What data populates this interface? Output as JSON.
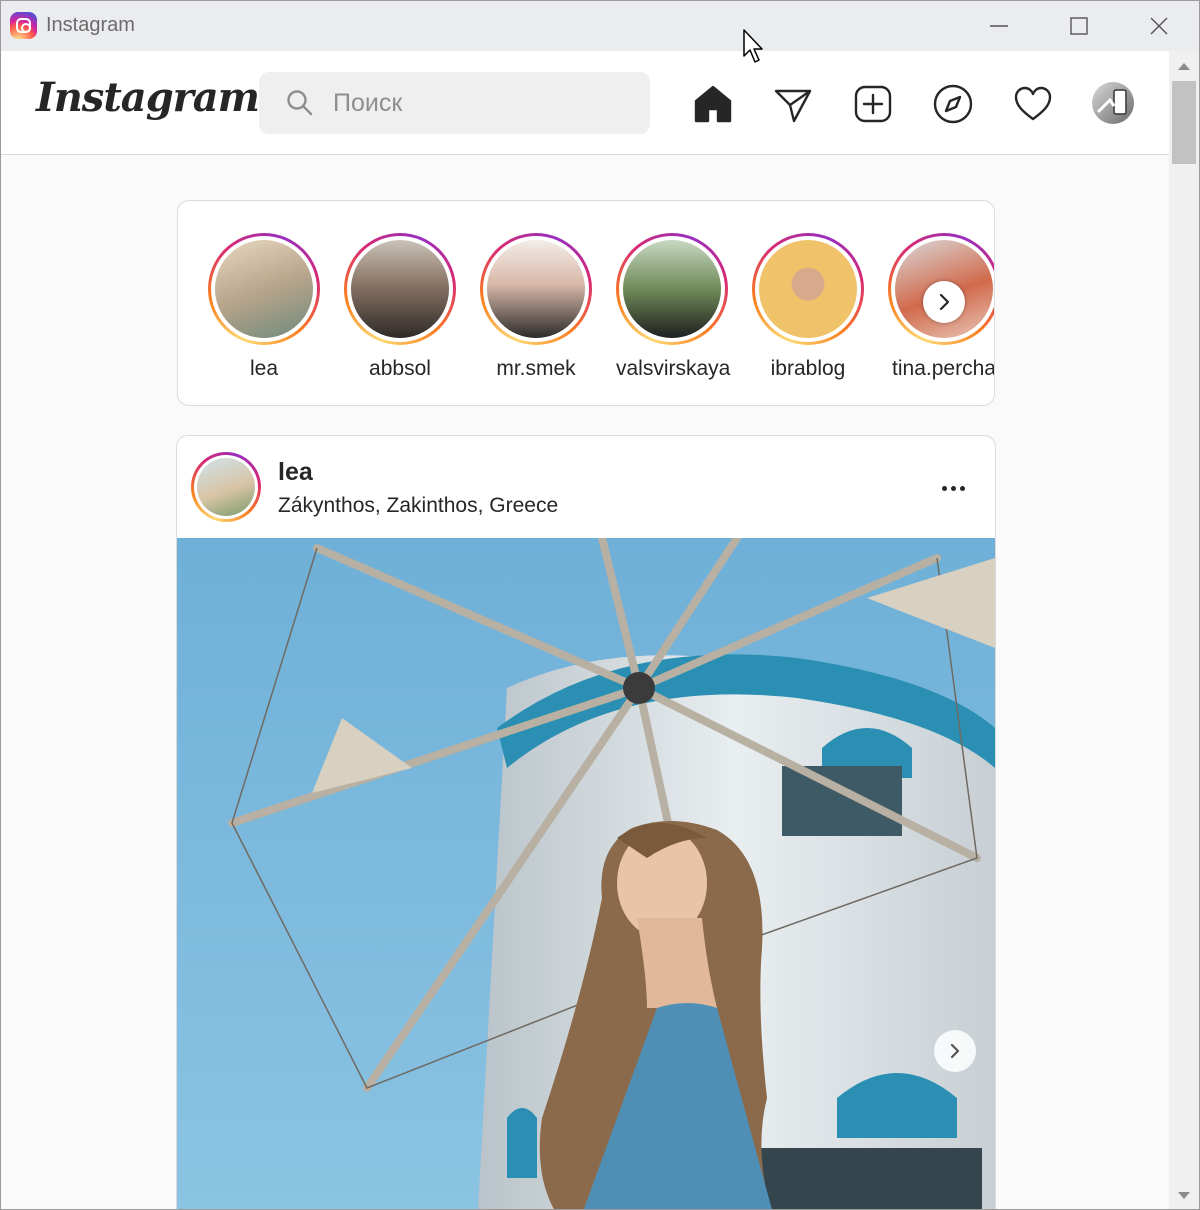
{
  "window": {
    "title": "Instagram"
  },
  "header": {
    "logo": "Instagram",
    "search_placeholder": "Поиск",
    "nav": [
      "home-icon",
      "direct-icon",
      "new-post-icon",
      "explore-icon",
      "activity-icon",
      "profile-avatar"
    ]
  },
  "stories": [
    {
      "name": "lea",
      "color": "#b9a58c"
    },
    {
      "name": "abbsol",
      "color": "#5a4a44"
    },
    {
      "name": "mr.smek",
      "color": "#c8b4a8"
    },
    {
      "name": "valsvirskaya",
      "color": "#6f8a58"
    },
    {
      "name": "ibrablog",
      "color": "#f0c26a"
    },
    {
      "name": "tina.percha",
      "color": "#d26a4c"
    }
  ],
  "post": {
    "user": "lea",
    "location": "Zákynthos, Zakinthos, Greece"
  },
  "colors": {
    "accent_gradient": [
      "#feda75",
      "#fa7e1e",
      "#d62976",
      "#962fbf"
    ],
    "text": "#262626",
    "border": "#dbdbdb"
  }
}
